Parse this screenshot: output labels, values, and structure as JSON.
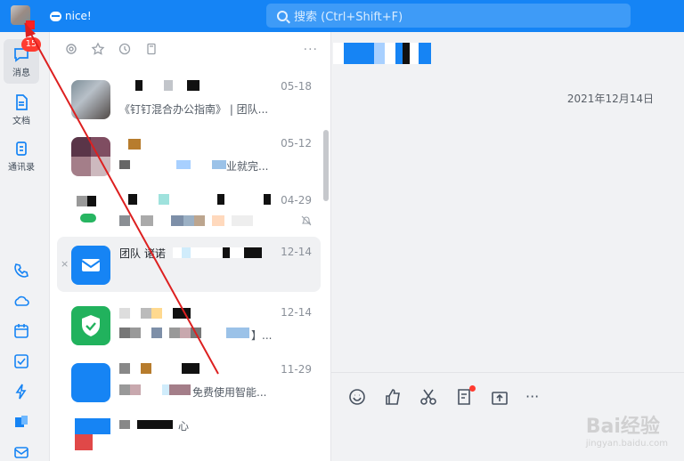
{
  "topbar": {
    "status_text": "nice!",
    "search_placeholder": "搜索 (Ctrl+Shift+F)"
  },
  "sidebar": {
    "badge_count": "15",
    "items": [
      {
        "label": "消息",
        "icon": "chat-bubble-icon"
      },
      {
        "label": "文档",
        "icon": "document-icon"
      },
      {
        "label": "通讯录",
        "icon": "contacts-icon"
      }
    ],
    "bottom_icons": [
      "phone-icon",
      "cloud-icon",
      "calendar-icon",
      "check-icon",
      "lightning-icon",
      "app-icon",
      "mail-icon"
    ]
  },
  "conversations": [
    {
      "time": "05-18",
      "preview": "《钉钉混合办公指南》 | 团队..."
    },
    {
      "time": "05-12",
      "preview": "业就完..."
    },
    {
      "time": "04-29",
      "preview": ""
    },
    {
      "time": "12-14",
      "title": "团队 诸诺",
      "preview": ""
    },
    {
      "time": "12-14",
      "preview": "】..."
    },
    {
      "time": "11-29",
      "preview": "免费使用智能..."
    },
    {
      "time": "",
      "preview": "心"
    }
  ],
  "chat": {
    "date": "2021年12月14日"
  },
  "watermark": {
    "brand": "Bai经验",
    "url": "jingyan.baidu.com"
  }
}
